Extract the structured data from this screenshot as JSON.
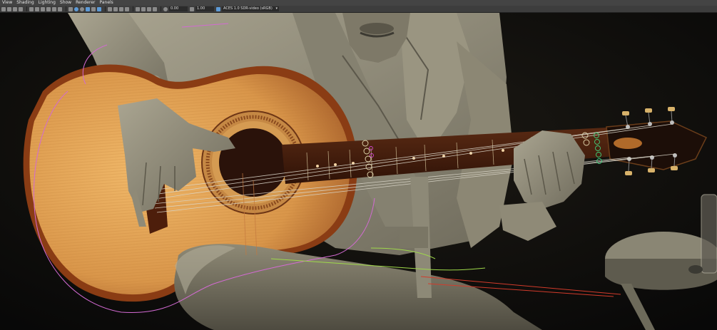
{
  "menu": {
    "items": [
      "View",
      "Shading",
      "Lighting",
      "Show",
      "Renderer",
      "Panels"
    ]
  },
  "toolbar": {
    "exposure_value": "0.00",
    "gamma_value": "1.00",
    "color_transform": "ACES 1.0 SDR-video (sRGB)"
  },
  "icons": {
    "camera": "camera-icon",
    "lock": "lock-icon",
    "grid": "grid-icon",
    "wireframe": "wireframe-icon",
    "smooth_shade": "smooth-shade-icon",
    "textured": "textured-icon",
    "lights": "lights-icon",
    "shadows": "shadows-icon",
    "isolate": "isolate-icon",
    "xray": "xray-icon",
    "exposure": "exposure-icon",
    "gamma": "gamma-icon",
    "color_mgmt": "color-management-icon"
  },
  "colors": {
    "menubar_bg": "#444444",
    "toolbar_bg": "#3d3d3d",
    "active_icon": "#5d9ad6",
    "guitar_top": "#e3a65a",
    "guitar_edge": "#8a3c14",
    "fretboard": "#4a1f0e",
    "figure_clay": "#a09c88",
    "background": "#0a0a0a"
  }
}
